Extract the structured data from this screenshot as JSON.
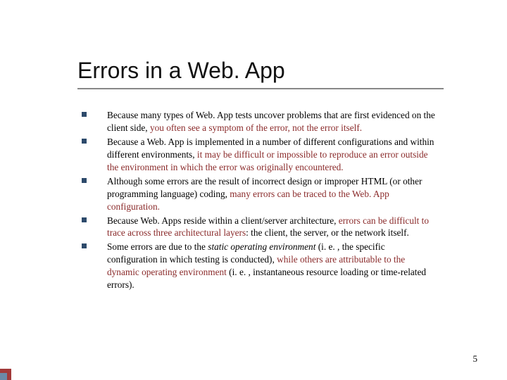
{
  "title": "Errors in a Web. App",
  "bullets": [
    {
      "plain1": "Because many types of Web. App tests uncover problems that are first evidenced on the client side, ",
      "emph1": "you often see a symptom of the error, not the error itself."
    },
    {
      "plain1": "Because a Web. App is implemented in a number of different configurations and within different environments, ",
      "emph1": "it may be difficult or impossible to reproduce an error outside the environment in which the error was originally encountered."
    },
    {
      "plain1": "Although some errors are the result of incorrect design or improper HTML (or other programming language) coding, ",
      "emph1": "many errors can be traced to the Web. App configuration."
    },
    {
      "plain1": "Because Web. Apps reside within a client/server architecture, ",
      "emph1": "errors can be difficult to trace across three architectural layers",
      "plain2": ": the client, the server, or the network itself."
    },
    {
      "plain1": "Some errors are due to the ",
      "italic1": "static operating environment",
      "plain2": " (i. e. , the specific configuration in which testing is conducted), ",
      "emph1": "while others are attributable to the dynamic operating environment",
      "plain3": " (i. e. , instantaneous resource loading or time-related errors)."
    }
  ],
  "page_number": "5"
}
